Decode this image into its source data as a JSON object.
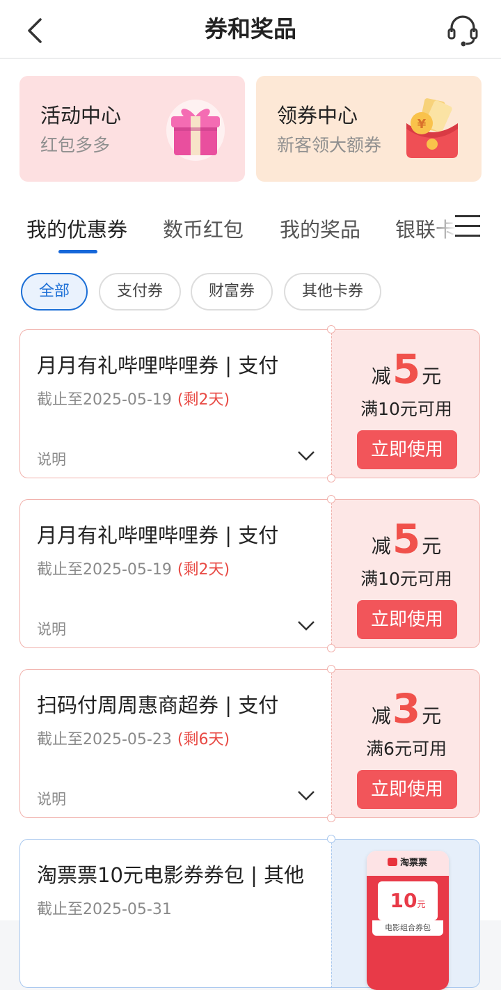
{
  "header": {
    "title": "券和奖品",
    "back_icon": "back-arrow-icon",
    "service_icon": "headset-icon"
  },
  "promos": [
    {
      "title": "活动中心",
      "subtitle": "红包多多",
      "icon": "gift-box-icon"
    },
    {
      "title": "领券中心",
      "subtitle": "新客领大额券",
      "icon": "red-envelope-icon"
    }
  ],
  "tabs": {
    "items": [
      "我的优惠券",
      "数币红包",
      "我的奖品",
      "银联卡"
    ],
    "active": "我的优惠券",
    "menu_icon": "menu-icon"
  },
  "filters": {
    "items": [
      "全部",
      "支付券",
      "财富券",
      "其他卡券"
    ],
    "active": "全部"
  },
  "coupons": [
    {
      "name": "月月有礼哔哩哔哩券 | 支付",
      "expiry": "截止至2025-05-19",
      "remaining": "(剩2天)",
      "note": "说明",
      "prefix": "减",
      "amount": "5",
      "unit": "元",
      "condition": "满10元可用",
      "button": "立即使用"
    },
    {
      "name": "月月有礼哔哩哔哩券 | 支付",
      "expiry": "截止至2025-05-19",
      "remaining": "(剩2天)",
      "note": "说明",
      "prefix": "减",
      "amount": "5",
      "unit": "元",
      "condition": "满10元可用",
      "button": "立即使用"
    },
    {
      "name": "扫码付周周惠商超券 | 支付",
      "expiry": "截止至2025-05-23",
      "remaining": "(剩6天)",
      "note": "说明",
      "prefix": "减",
      "amount": "3",
      "unit": "元",
      "condition": "满6元可用",
      "button": "立即使用"
    },
    {
      "name": "淘票票10元电影券券包 | 其他",
      "expiry": "截止至2025-05-31",
      "image_brand": "淘票票",
      "image_value": "10",
      "image_unit": "元",
      "image_caption": "电影组合券包"
    }
  ],
  "colors": {
    "accent_blue": "#1c6fd6",
    "coupon_red": "#f2555a",
    "amount_red": "#f0514b"
  }
}
